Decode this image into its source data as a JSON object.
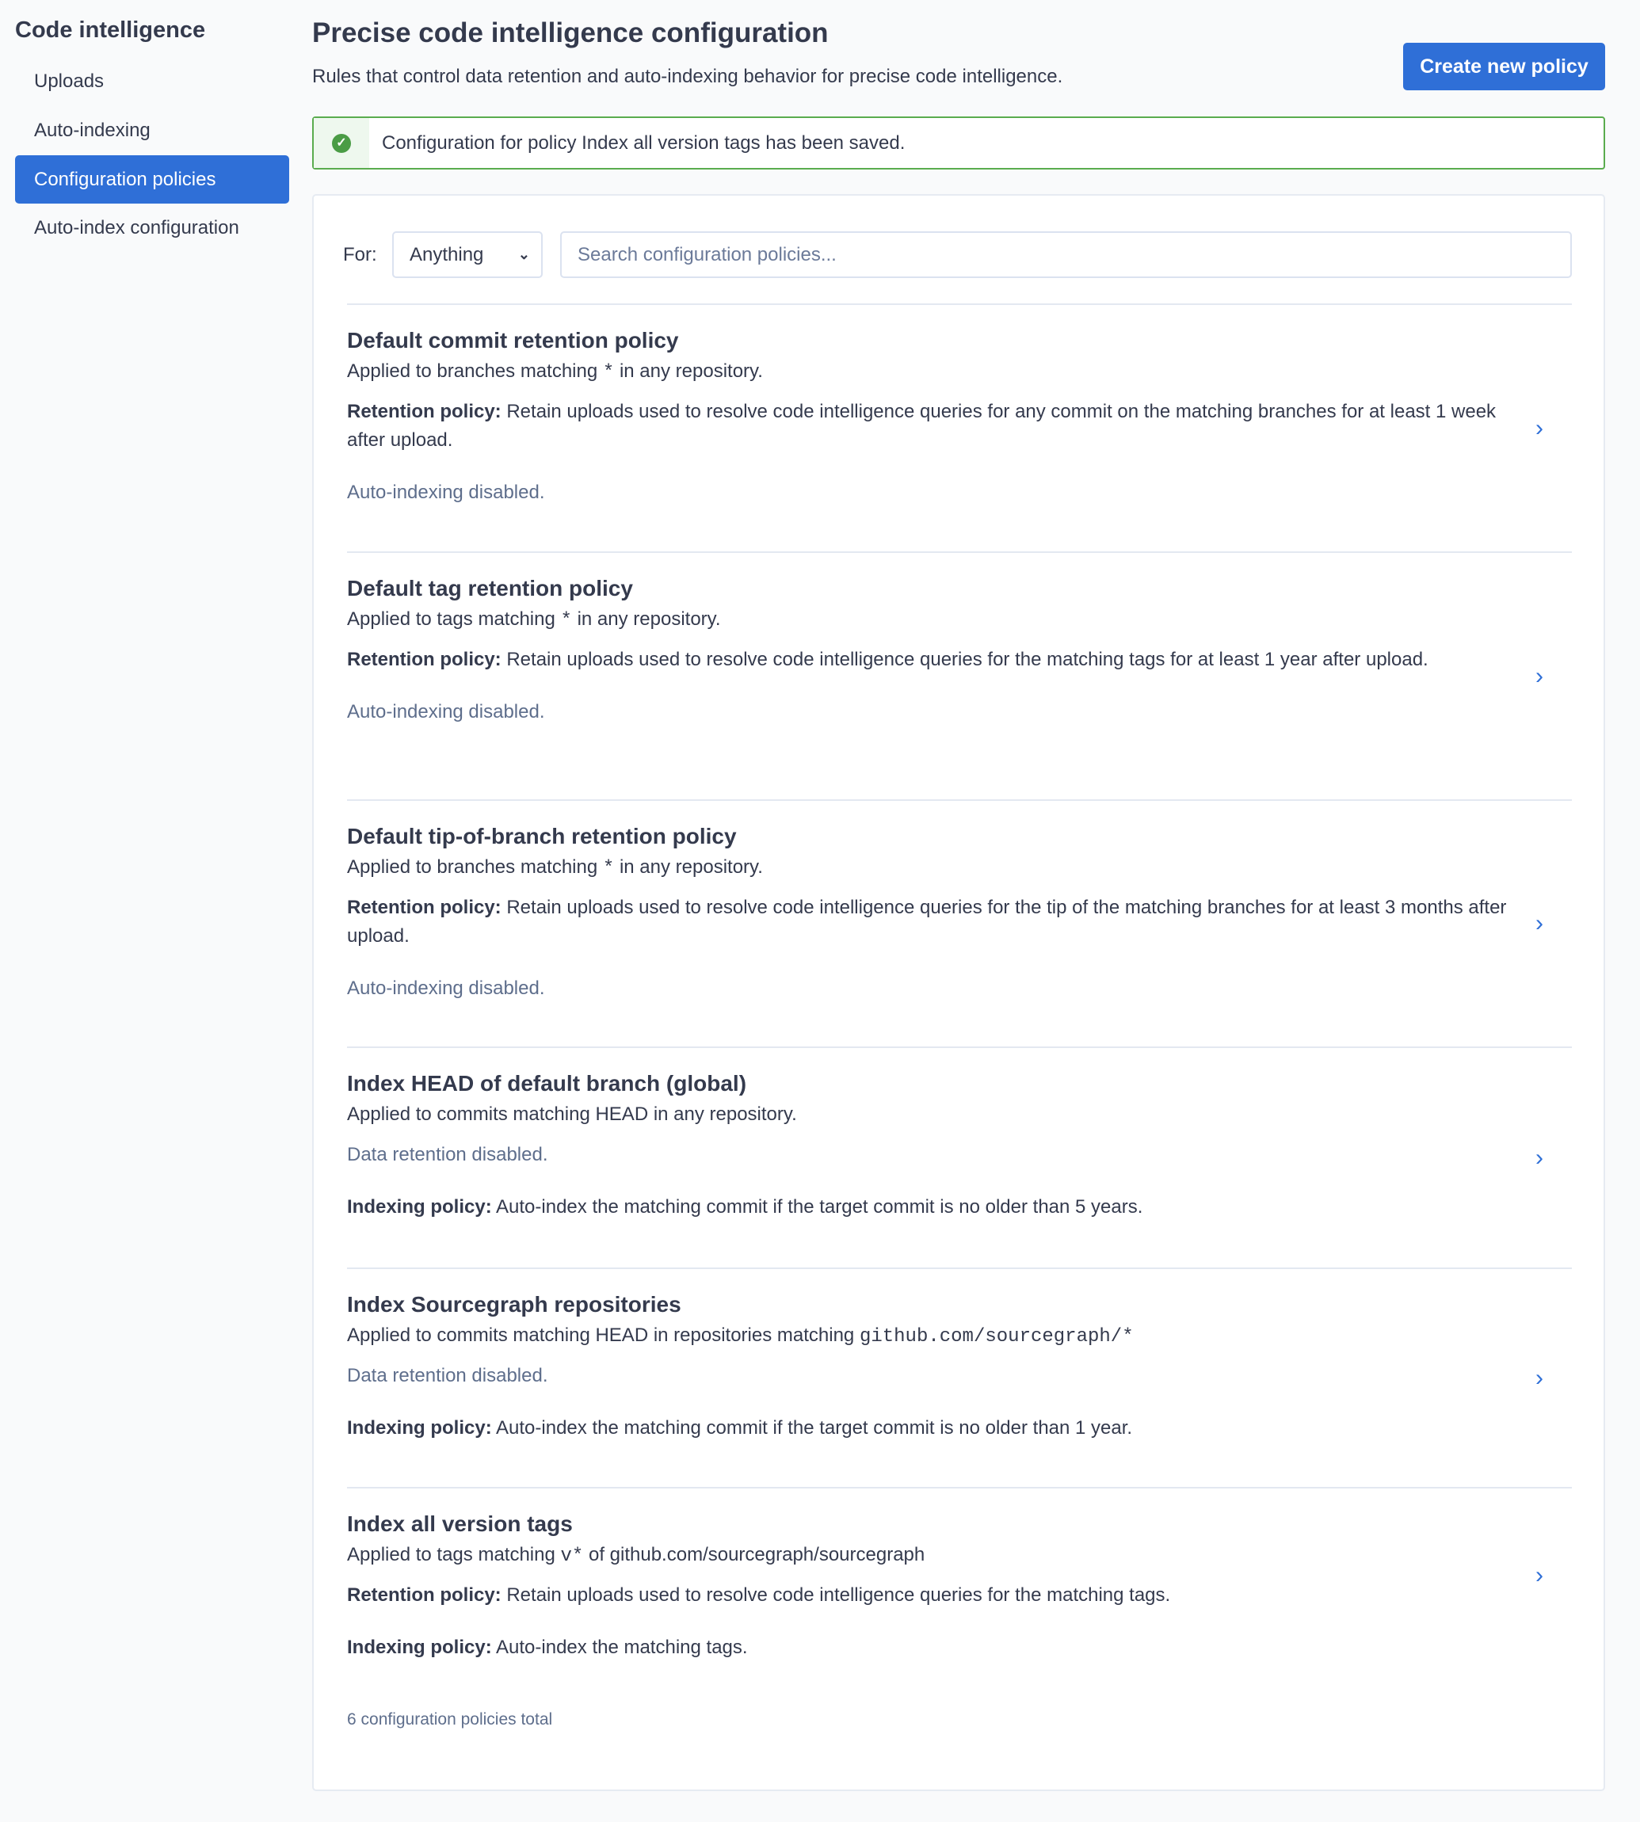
{
  "sidebar": {
    "title": "Code intelligence",
    "items": [
      {
        "label": "Uploads",
        "active": false
      },
      {
        "label": "Auto-indexing",
        "active": false
      },
      {
        "label": "Configuration policies",
        "active": true
      },
      {
        "label": "Auto-index configuration",
        "active": false
      }
    ]
  },
  "header": {
    "title": "Precise code intelligence configuration",
    "subtitle": "Rules that control data retention and auto-indexing behavior for precise code intelligence.",
    "create_button": "Create new policy"
  },
  "alert": {
    "icon": "check-circle-icon",
    "text": "Configuration for policy Index all version tags has been saved.",
    "color": "#5aac4e"
  },
  "filter": {
    "for_label": "For:",
    "select_value": "Anything",
    "search_placeholder": "Search configuration policies..."
  },
  "policies": [
    {
      "title": "Default commit retention policy",
      "applied": {
        "prefix": "Applied to branches matching ",
        "pattern": "*",
        "suffix": " in any repository."
      },
      "sections": [
        {
          "label": "Retention policy:",
          "text": " Retain uploads used to resolve code intelligence queries for any commit on the matching branches for at least 1 week after upload.",
          "muted": false
        },
        {
          "label": "",
          "text": "Auto-indexing disabled.",
          "muted": true
        }
      ]
    },
    {
      "title": "Default tag retention policy",
      "applied": {
        "prefix": "Applied to tags matching ",
        "pattern": "*",
        "suffix": " in any repository."
      },
      "sections": [
        {
          "label": "Retention policy:",
          "text": " Retain uploads used to resolve code intelligence queries for the matching tags for at least 1 year after upload.",
          "muted": false
        },
        {
          "label": "",
          "text": "Auto-indexing disabled.",
          "muted": true
        }
      ]
    },
    {
      "title": "Default tip-of-branch retention policy",
      "applied": {
        "prefix": "Applied to branches matching ",
        "pattern": "*",
        "suffix": " in any repository."
      },
      "sections": [
        {
          "label": "Retention policy:",
          "text": " Retain uploads used to resolve code intelligence queries for the tip of the matching branches for at least 3 months after upload.",
          "muted": false
        },
        {
          "label": "",
          "text": "Auto-indexing disabled.",
          "muted": true
        }
      ]
    },
    {
      "title": "Index HEAD of default branch (global)",
      "applied": {
        "prefix": "Applied to commits matching HEAD in any repository.",
        "pattern": "",
        "suffix": ""
      },
      "sections": [
        {
          "label": "",
          "text": "Data retention disabled.",
          "muted": true
        },
        {
          "label": "Indexing policy:",
          "text": " Auto-index the matching commit if the target commit is no older than 5 years.",
          "muted": false
        }
      ]
    },
    {
      "title": "Index Sourcegraph repositories",
      "applied": {
        "prefix": "Applied to commits matching HEAD in repositories matching ",
        "pattern": "github.com/sourcegraph/*",
        "suffix": ""
      },
      "sections": [
        {
          "label": "",
          "text": "Data retention disabled.",
          "muted": true
        },
        {
          "label": "Indexing policy:",
          "text": " Auto-index the matching commit if the target commit is no older than 1 year.",
          "muted": false
        }
      ]
    },
    {
      "title": "Index all version tags",
      "applied": {
        "prefix": "Applied to tags matching ",
        "pattern": "v*",
        "suffix": " of github.com/sourcegraph/sourcegraph"
      },
      "sections": [
        {
          "label": "Retention policy:",
          "text": " Retain uploads used to resolve code intelligence queries for the matching tags.",
          "muted": false
        },
        {
          "label": "Indexing policy:",
          "text": " Auto-index the matching tags.",
          "muted": false
        }
      ]
    }
  ],
  "footer": {
    "summary": "6 configuration policies total"
  },
  "colors": {
    "accent": "#2f6fd7",
    "text": "#343a4d",
    "muted": "#5e6e8c",
    "success": "#4a9c45"
  }
}
